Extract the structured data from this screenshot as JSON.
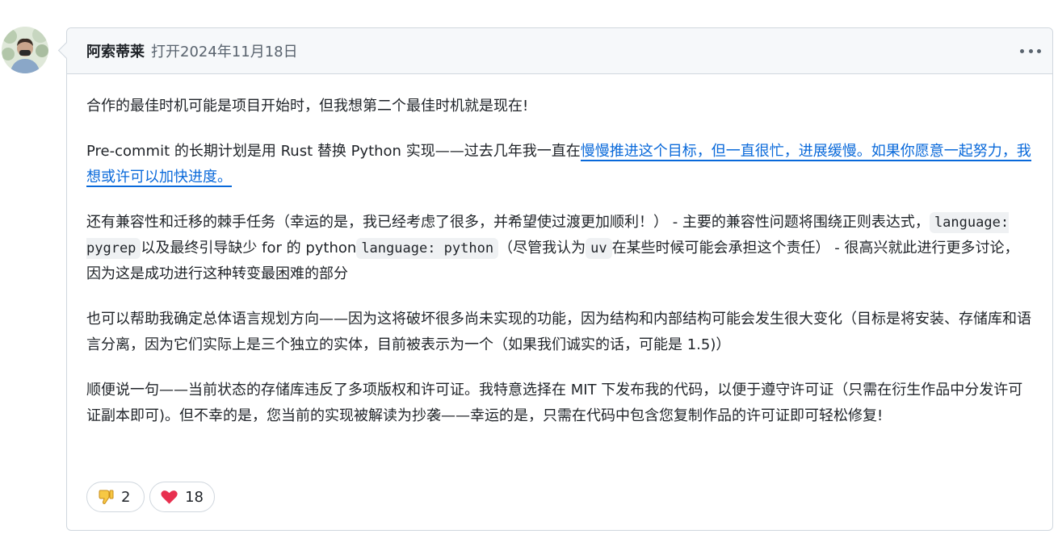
{
  "comment": {
    "author": "阿索蒂莱",
    "opened_text": "打开2024年11月18日",
    "paragraphs": {
      "p1": "合作的最佳时机可能是项目开始时，但我想第二个最佳时机就是现在!",
      "p2_before_link": "Pre-commit 的长期计划是用 Rust 替换 Python 实现——过去几年我一直在",
      "p2_link": "慢慢推进这个目标，但一直很忙，进展缓慢。如果你愿意一起努力，我想或许可以加快进度。",
      "p3_part1": "还有兼容性和迁移的棘手任务（幸运的是，我已经考虑了很多，并希望使过渡更加顺利！） - 主要的兼容性问题将围绕正则表达式，",
      "p3_code1": "language: pygrep",
      "p3_part2": "以及最终引导缺少 for 的 python",
      "p3_code2": "language: python",
      "p3_part3": "（尽管我认为",
      "p3_code3": "uv",
      "p3_part4": "在某些时候可能会承担这个责任） - 很高兴就此进行更多讨论，因为这是成功进行这种转变最困难的部分",
      "p4": "也可以帮助我确定总体语言规划方向——因为这将破坏很多尚未实现的功能，因为结构和内部结构可能会发生很大变化（目标是将安装、存储库和语言分离，因为它们实际上是三个独立的实体，目前被表示为一个（如果我们诚实的话，可能是 1.5)）",
      "p5": "顺便说一句——当前状态的存储库违反了多项版权和许可证。我特意选择在 MIT 下发布我的代码，以便于遵守许可证（只需在衍生作品中分发许可证副本即可)。但不幸的是，您当前的实现被解读为抄袭——幸运的是，只需在代码中包含您复制作品的许可证即可轻松修复!"
    },
    "reactions": [
      {
        "icon": "thumbs-down-icon",
        "count": "2"
      },
      {
        "icon": "heart-icon",
        "count": "18"
      }
    ]
  },
  "colors": {
    "link": "#0969da",
    "border": "#d0d7de",
    "header_bg": "#f6f8fa"
  }
}
